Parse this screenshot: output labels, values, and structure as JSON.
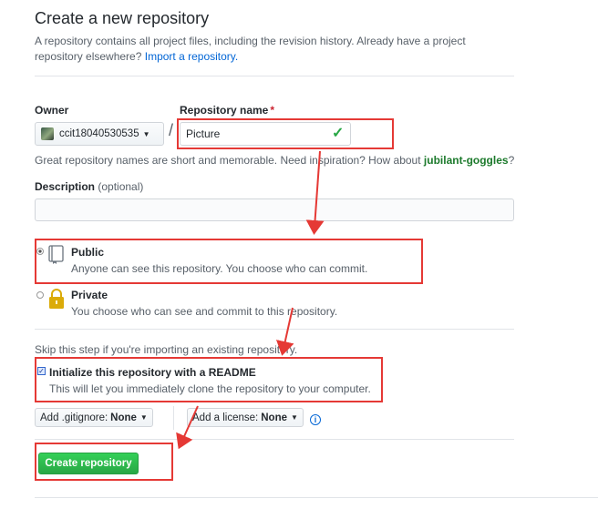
{
  "header": {
    "title": "Create a new repository",
    "description": "A repository contains all project files, including the revision history. Already have a project repository elsewhere?",
    "import_link": "Import a repository."
  },
  "owner": {
    "label": "Owner",
    "value": "ccit18040530535"
  },
  "repo_name": {
    "label": "Repository name",
    "required_mark": "*",
    "value": "Picture",
    "hint_prefix": "Great repository names are short and memorable. Need inspiration? How about",
    "suggestion": "jubilant-goggles",
    "hint_suffix": "?"
  },
  "description": {
    "label": "Description",
    "optional": "(optional)",
    "value": ""
  },
  "visibility": {
    "public_title": "Public",
    "public_desc": "Anyone can see this repository. You choose who can commit.",
    "private_title": "Private",
    "private_desc": "You choose who can see and commit to this repository.",
    "selected": "public"
  },
  "init": {
    "skip_text": "Skip this step if you're importing an existing repository.",
    "readme_label": "Initialize this repository with a README",
    "readme_desc": "This will let you immediately clone the repository to your computer.",
    "readme_checked": true
  },
  "gitignore": {
    "prefix": "Add .gitignore:",
    "value": "None"
  },
  "license": {
    "prefix": "Add a license:",
    "value": "None"
  },
  "submit_label": "Create repository",
  "colors": {
    "annotation_red": "#e53935",
    "primary_green": "#28a745",
    "link_blue": "#0366d6"
  }
}
